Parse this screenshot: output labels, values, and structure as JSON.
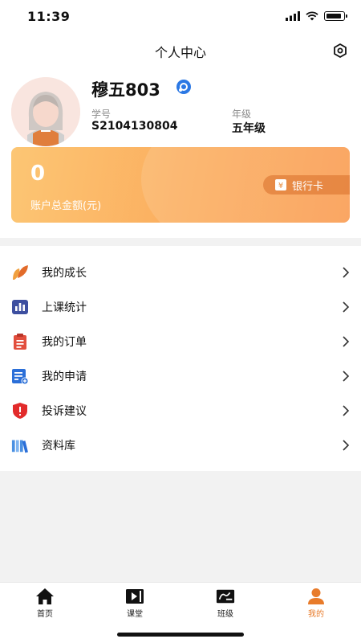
{
  "status_bar": {
    "time": "11:39"
  },
  "nav": {
    "title": "个人中心",
    "settings_icon": "settings-hexagon-icon"
  },
  "profile": {
    "name": "穆五803",
    "student_id_label": "学号",
    "student_id": "S2104130804",
    "grade_label": "年级",
    "grade": "五年级"
  },
  "balance": {
    "amount": "0",
    "label": "账户总金额(元)",
    "bank_button": "银行卡"
  },
  "menu": [
    {
      "label": "我的成长",
      "icon": "growth-leaf-icon",
      "color": "#e8822f"
    },
    {
      "label": "上课统计",
      "icon": "class-stats-icon",
      "color": "#3d4fa0"
    },
    {
      "label": "我的订单",
      "icon": "order-clipboard-icon",
      "color": "#e24e3d"
    },
    {
      "label": "我的申请",
      "icon": "application-icon",
      "color": "#2b6fd8"
    },
    {
      "label": "投诉建议",
      "icon": "complaint-shield-icon",
      "color": "#e22b2b"
    },
    {
      "label": "资料库",
      "icon": "library-books-icon",
      "color": "#4a90e2"
    }
  ],
  "tabs": [
    {
      "label": "首页",
      "icon": "home-icon"
    },
    {
      "label": "课堂",
      "icon": "classroom-video-icon"
    },
    {
      "label": "班级",
      "icon": "class-board-icon"
    },
    {
      "label": "我的",
      "icon": "profile-person-icon",
      "active": true
    }
  ],
  "colors": {
    "accent": "#e87b2a",
    "card_gradient_start": "#fcc674",
    "card_gradient_end": "#fa9a4e"
  }
}
